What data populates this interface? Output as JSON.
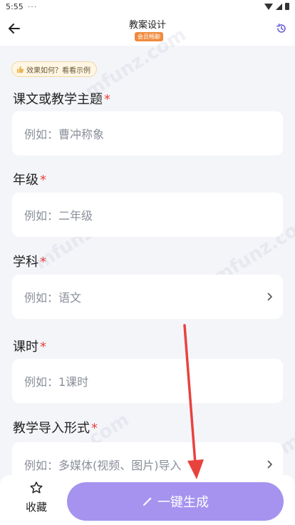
{
  "status": {
    "time": "5:55",
    "dots": "···"
  },
  "nav": {
    "title": "教案设计",
    "badge": "会员畅聊"
  },
  "tip": {
    "label": "效果如何？看看示例"
  },
  "fields": [
    {
      "label": "课文或教学主题",
      "required": "*",
      "placeholder": "例如：曹冲称象",
      "has_chevron": false
    },
    {
      "label": "年级",
      "required": "*",
      "placeholder": "例如：二年级",
      "has_chevron": false
    },
    {
      "label": "学科",
      "required": "*",
      "placeholder": "例如：语文",
      "has_chevron": true
    },
    {
      "label": "课时",
      "required": "*",
      "placeholder": "例如：1课时",
      "has_chevron": false
    },
    {
      "label": "教学导入形式",
      "required": "*",
      "placeholder": "例如：多媒体(视频、图片)导入",
      "has_chevron": true
    }
  ],
  "bottom": {
    "favorite_label": "收藏",
    "generate_label": "一键生成"
  },
  "watermark": "mfunz.com",
  "colors": {
    "accent": "#a593ef",
    "required": "#e8423e",
    "badge": "#f08a3c",
    "annotation_arrow": "#e8423e"
  }
}
